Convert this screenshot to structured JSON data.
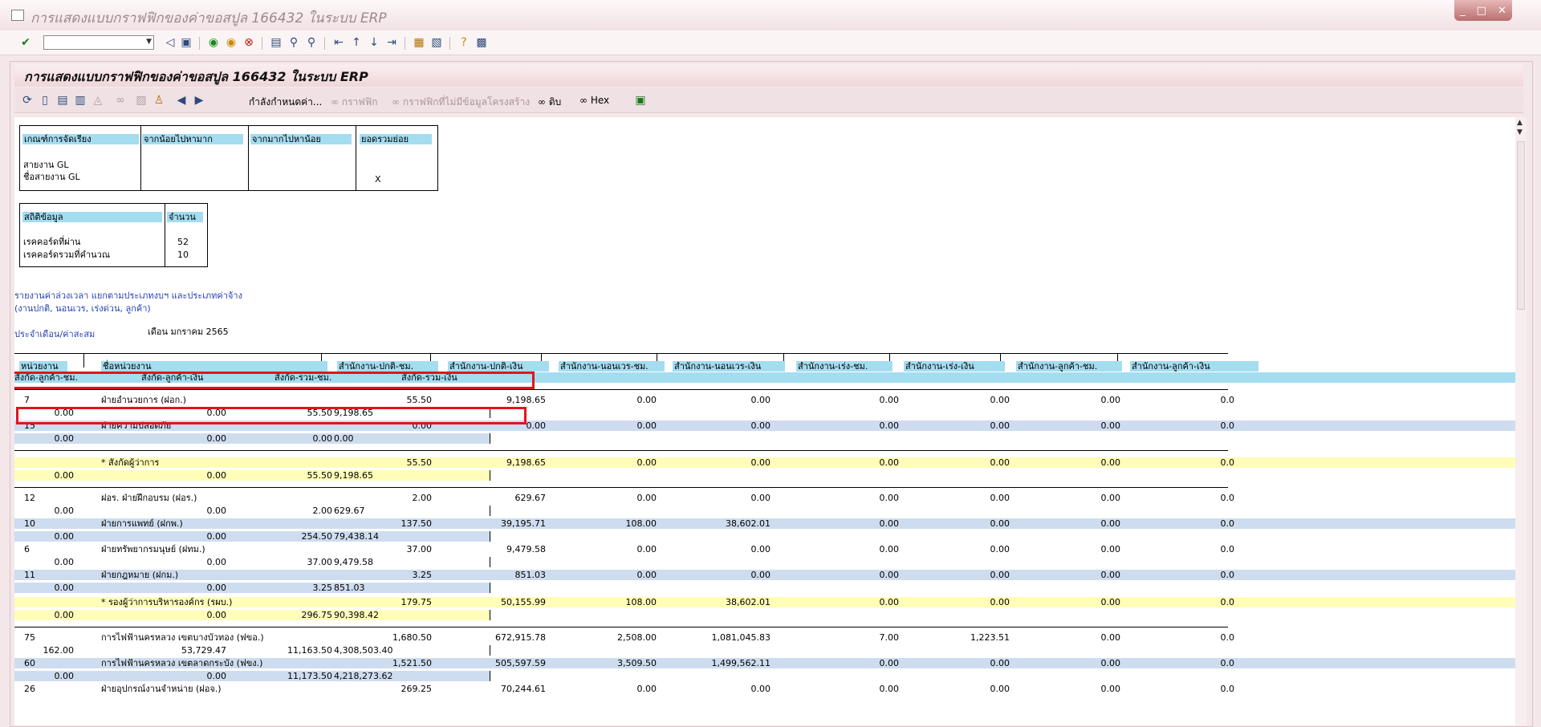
{
  "window": {
    "title": "การแสดงแบบกราฟฟิกของค่าขอสปูล 166432 ในระบบ ERP",
    "controls": [
      "_",
      "□",
      "✕"
    ]
  },
  "screen_title": "การแสดงแบบกราฟฟิกของค่าขอสปูล 166432 ในระบบ ERP",
  "app_toolbar": {
    "set_value": "กำลังกำหนดค่า...",
    "graphic": "กราฟฟิก",
    "graphic_no_struct": "กราฟฟิกที่ไม่มีข้อมูลโครงสร้าง",
    "raw": "ดิบ",
    "hex": "Hex"
  },
  "sort_box": {
    "headers": [
      "เกณฑ์การจัดเรียง",
      "จากน้อยไปหามาก",
      "จากมากไปหาน้อย",
      "ยอดรวมย่อย"
    ],
    "rows": [
      "สายงาน GL",
      "ชื่อสายงาน GL"
    ],
    "mark": "X"
  },
  "stats_box": {
    "headers": [
      "สถิติข้อมูล",
      "จำนวน"
    ],
    "rows": [
      {
        "label": "เรคคอร์ดที่ผ่าน",
        "value": "52"
      },
      {
        "label": "เรคคอร์ดรวมที่คำนวณ",
        "value": "10"
      }
    ]
  },
  "report": {
    "line1": "รายงานค่าล่วงเวลา แยกตามประเภทงบฯ และประเภทค่าจ้าง",
    "line2": "(งานปกติ, นอนเวร, เร่งด่วน, ลูกค้า)",
    "period_label": "ประจำเดือน/ค่าสะสม",
    "period_value": "เดือน มกราคม 2565"
  },
  "table": {
    "headers1": [
      "หน่วยงาน",
      "ชื่อหน่วยงาน",
      "สำนักงาน-ปกติ-ชม.",
      "สำนักงาน-ปกติ-เงิน",
      "สำนักงาน-นอนเวร-ชม.",
      "สำนักงาน-นอนเวร-เงิน",
      "สำนักงาน-เร่ง-ชม.",
      "สำนักงาน-เร่ง-เงิน",
      "สำนักงาน-ลูกค้า-ชม.",
      "สำนักงาน-ลูกค้า-เงิน"
    ],
    "headers2": [
      "สังกัด-ลูกค้า-ชม.",
      "สังกัด-ลูกค้า-เงิน",
      "สังกัด-รวม-ชม.",
      "สังกัด-รวม-เงิน"
    ],
    "rows": [
      {
        "a": [
          "7",
          "ฝ่ายอำนวยการ (ฝอก.)",
          "55.50",
          "9,198.65",
          "0.00",
          "0.00",
          "0.00",
          "0.00",
          "0.00",
          "0.0"
        ],
        "b": [
          "0.00",
          "0.00",
          "55.50",
          "9,198.65"
        ],
        "shade": "none"
      },
      {
        "a": [
          "15",
          "ฝ่ายความปลอดภัย",
          "0.00",
          "0.00",
          "0.00",
          "0.00",
          "0.00",
          "0.00",
          "0.00",
          "0.0"
        ],
        "b": [
          "0.00",
          "0.00",
          "0.00",
          "0.00"
        ],
        "shade": "blue"
      },
      {
        "a": [
          "",
          "* สังกัดผู้ว่าการ",
          "55.50",
          "9,198.65",
          "0.00",
          "0.00",
          "0.00",
          "0.00",
          "0.00",
          "0.0"
        ],
        "b": [
          "0.00",
          "0.00",
          "55.50",
          "9,198.65"
        ],
        "shade": "yellow"
      },
      {
        "a": [
          "12",
          "ฝอร. ฝ่ายฝึกอบรม (ฝอร.)",
          "2.00",
          "629.67",
          "0.00",
          "0.00",
          "0.00",
          "0.00",
          "0.00",
          "0.0"
        ],
        "b": [
          "0.00",
          "0.00",
          "2.00",
          "629.67"
        ],
        "shade": "none"
      },
      {
        "a": [
          "10",
          "ฝ่ายการแพทย์ (ฝกพ.)",
          "137.50",
          "39,195.71",
          "108.00",
          "38,602.01",
          "0.00",
          "0.00",
          "0.00",
          "0.0"
        ],
        "b": [
          "0.00",
          "0.00",
          "254.50",
          "79,438.14"
        ],
        "shade": "blue"
      },
      {
        "a": [
          "6",
          "ฝ่ายทรัพยากรมนุษย์ (ฝทม.)",
          "37.00",
          "9,479.58",
          "0.00",
          "0.00",
          "0.00",
          "0.00",
          "0.00",
          "0.0"
        ],
        "b": [
          "0.00",
          "0.00",
          "37.00",
          "9,479.58"
        ],
        "shade": "none"
      },
      {
        "a": [
          "11",
          "ฝ่ายกฎหมาย (ฝกม.)",
          "3.25",
          "851.03",
          "0.00",
          "0.00",
          "0.00",
          "0.00",
          "0.00",
          "0.0"
        ],
        "b": [
          "0.00",
          "0.00",
          "3.25",
          "851.03"
        ],
        "shade": "blue"
      },
      {
        "a": [
          "",
          "* รองผู้ว่าการบริหารองค์กร (รผบ.)",
          "179.75",
          "50,155.99",
          "108.00",
          "38,602.01",
          "0.00",
          "0.00",
          "0.00",
          "0.0"
        ],
        "b": [
          "0.00",
          "0.00",
          "296.75",
          "90,398.42"
        ],
        "shade": "yellow"
      },
      {
        "a": [
          "75",
          "การไฟฟ้านครหลวง เขตบางบัวทอง (ฟขอ.)",
          "1,680.50",
          "672,915.78",
          "2,508.00",
          "1,081,045.83",
          "7.00",
          "1,223.51",
          "0.00",
          "0.0"
        ],
        "b": [
          "162.00",
          "53,729.47",
          "11,163.50",
          "4,308,503.40"
        ],
        "shade": "none"
      },
      {
        "a": [
          "60",
          "การไฟฟ้านครหลวง เขตลาดกระบัง (ฟขง.)",
          "1,521.50",
          "505,597.59",
          "3,509.50",
          "1,499,562.11",
          "0.00",
          "0.00",
          "0.00",
          "0.0"
        ],
        "b": [
          "0.00",
          "0.00",
          "11,173.50",
          "4,218,273.62"
        ],
        "shade": "blue"
      },
      {
        "a": [
          "26",
          "ฝ่ายอุปกรณ์งานจำหน่าย (ฝอจ.)",
          "269.25",
          "70,244.61",
          "0.00",
          "0.00",
          "0.00",
          "0.00",
          "0.00",
          "0.0"
        ],
        "b": [
          "",
          "",
          "",
          ""
        ],
        "shade": "none"
      }
    ]
  }
}
